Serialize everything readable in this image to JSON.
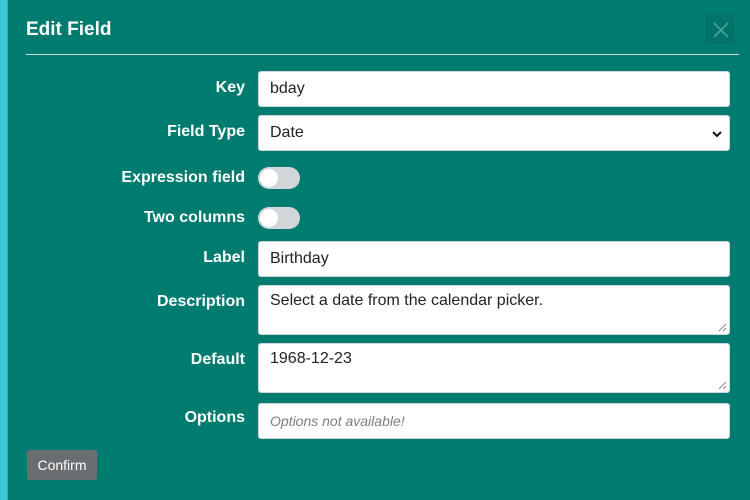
{
  "dialog": {
    "title": "Edit Field",
    "close_icon": "close-icon"
  },
  "form": {
    "key": {
      "label": "Key",
      "value": "bday"
    },
    "field_type": {
      "label": "Field Type",
      "selected": "Date"
    },
    "expression_field": {
      "label": "Expression field",
      "on": false
    },
    "two_columns": {
      "label": "Two columns",
      "on": false
    },
    "label_field": {
      "label": "Label",
      "value": "Birthday"
    },
    "description": {
      "label": "Description",
      "value": "Select a date from the calendar picker."
    },
    "default": {
      "label": "Default",
      "value": "1968-12-23"
    },
    "options": {
      "label": "Options",
      "placeholder": "Options not available!"
    }
  },
  "footer": {
    "confirm_label": "Confirm"
  },
  "colors": {
    "dialog_bg": "#007b70",
    "button_bg": "#6a6e70",
    "toggle_off": "#d3d6d8"
  }
}
